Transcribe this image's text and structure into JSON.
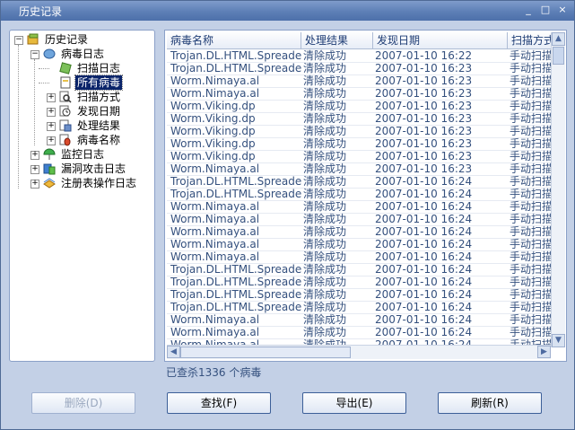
{
  "window": {
    "title": "历史记录",
    "minimize": "_",
    "restore": "□",
    "close": "×"
  },
  "tree": {
    "root": "历史记录",
    "virus_log": "病毒日志",
    "scan_log": "扫描日志",
    "all_viruses": "所有病毒",
    "scan_method": "扫描方式",
    "found_date": "发现日期",
    "result": "处理结果",
    "virus_name": "病毒名称",
    "monitor_log": "监控日志",
    "exploit_log": "漏洞攻击日志",
    "registry_log": "注册表操作日志"
  },
  "table": {
    "columns": [
      "病毒名称",
      "处理结果",
      "发现日期",
      "扫描方式"
    ],
    "rows": [
      [
        "Trojan.DL.HTML.Spreader.a",
        "清除成功",
        "2007-01-10 16:22",
        "手动扫描"
      ],
      [
        "Trojan.DL.HTML.Spreader.a",
        "清除成功",
        "2007-01-10 16:23",
        "手动扫描"
      ],
      [
        "Worm.Nimaya.al",
        "清除成功",
        "2007-01-10 16:23",
        "手动扫描"
      ],
      [
        "Worm.Nimaya.al",
        "清除成功",
        "2007-01-10 16:23",
        "手动扫描"
      ],
      [
        "Worm.Viking.dp",
        "清除成功",
        "2007-01-10 16:23",
        "手动扫描"
      ],
      [
        "Worm.Viking.dp",
        "清除成功",
        "2007-01-10 16:23",
        "手动扫描"
      ],
      [
        "Worm.Viking.dp",
        "清除成功",
        "2007-01-10 16:23",
        "手动扫描"
      ],
      [
        "Worm.Viking.dp",
        "清除成功",
        "2007-01-10 16:23",
        "手动扫描"
      ],
      [
        "Worm.Viking.dp",
        "清除成功",
        "2007-01-10 16:23",
        "手动扫描"
      ],
      [
        "Worm.Nimaya.al",
        "清除成功",
        "2007-01-10 16:23",
        "手动扫描"
      ],
      [
        "Trojan.DL.HTML.Spreader.a",
        "清除成功",
        "2007-01-10 16:24",
        "手动扫描"
      ],
      [
        "Trojan.DL.HTML.Spreader.a",
        "清除成功",
        "2007-01-10 16:24",
        "手动扫描"
      ],
      [
        "Worm.Nimaya.al",
        "清除成功",
        "2007-01-10 16:24",
        "手动扫描"
      ],
      [
        "Worm.Nimaya.al",
        "清除成功",
        "2007-01-10 16:24",
        "手动扫描"
      ],
      [
        "Worm.Nimaya.al",
        "清除成功",
        "2007-01-10 16:24",
        "手动扫描"
      ],
      [
        "Worm.Nimaya.al",
        "清除成功",
        "2007-01-10 16:24",
        "手动扫描"
      ],
      [
        "Worm.Nimaya.al",
        "清除成功",
        "2007-01-10 16:24",
        "手动扫描"
      ],
      [
        "Trojan.DL.HTML.Spreader.a",
        "清除成功",
        "2007-01-10 16:24",
        "手动扫描"
      ],
      [
        "Trojan.DL.HTML.Spreader.a",
        "清除成功",
        "2007-01-10 16:24",
        "手动扫描"
      ],
      [
        "Trojan.DL.HTML.Spreader.a",
        "清除成功",
        "2007-01-10 16:24",
        "手动扫描"
      ],
      [
        "Trojan.DL.HTML.Spreader.a",
        "清除成功",
        "2007-01-10 16:24",
        "手动扫描"
      ],
      [
        "Worm.Nimaya.al",
        "清除成功",
        "2007-01-10 16:24",
        "手动扫描"
      ],
      [
        "Worm.Nimaya.al",
        "清除成功",
        "2007-01-10 16:24",
        "手动扫描"
      ],
      [
        "Worm.Nimaya.al",
        "清除成功",
        "2007-01-10 16:24",
        "手动扫描"
      ]
    ]
  },
  "status": "已查杀1336 个病毒",
  "buttons": {
    "delete": "删除(D)",
    "find": "查找(F)",
    "export": "导出(E)",
    "refresh": "刷新(R)"
  },
  "scroll": {
    "up": "▲",
    "down": "▼",
    "left": "◀",
    "right": "▶"
  },
  "colors": {
    "selection": "#0a246a",
    "title_bar": "#5d7fb6",
    "list_text": "#34507e"
  }
}
